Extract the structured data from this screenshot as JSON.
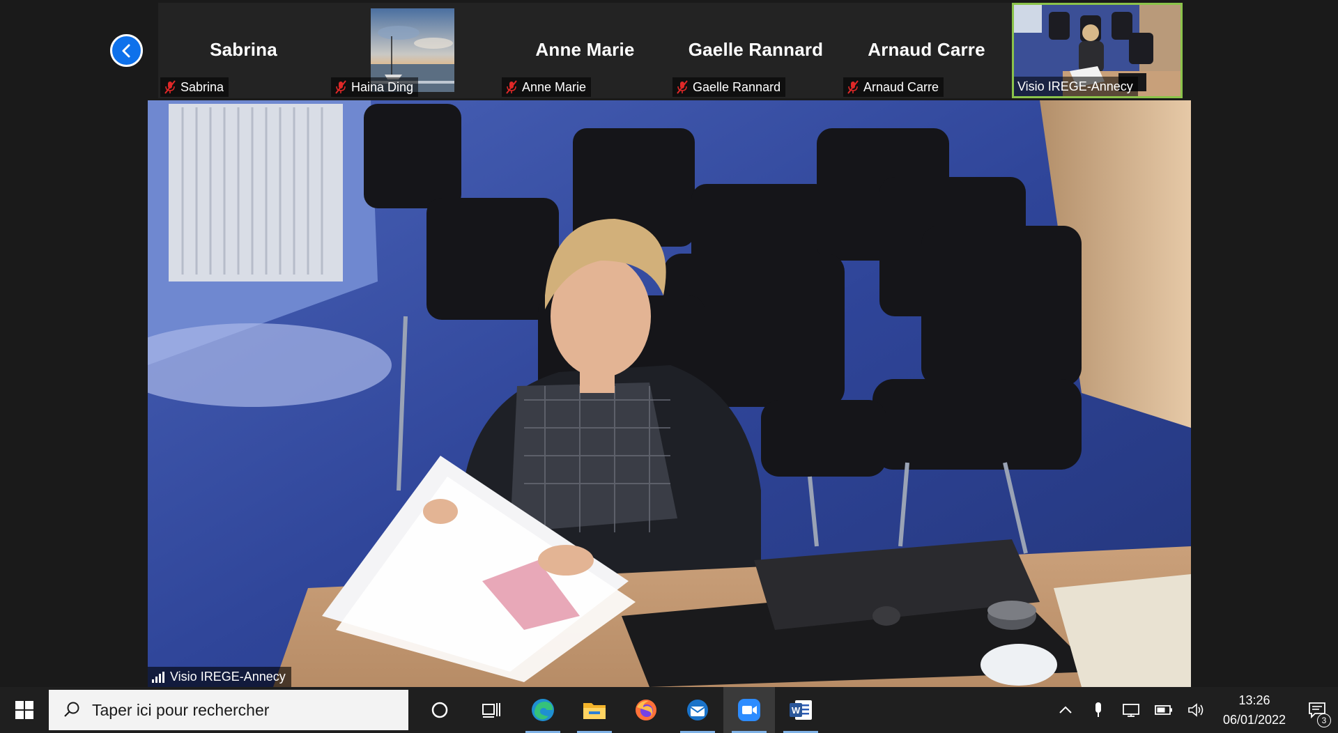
{
  "meeting": {
    "participants": [
      {
        "display_name": "Sabrina",
        "label": "Sabrina",
        "muted": true,
        "video": false
      },
      {
        "display_name": "",
        "label": "Haina Ding",
        "muted": true,
        "video": true
      },
      {
        "display_name": "Anne Marie",
        "label": "Anne Marie",
        "muted": true,
        "video": false
      },
      {
        "display_name": "Gaelle Rannard",
        "label": "Gaelle Rannard",
        "muted": true,
        "video": false
      },
      {
        "display_name": "Arnaud Carre",
        "label": "Arnaud Carre",
        "muted": true,
        "video": false
      },
      {
        "display_name": "",
        "label": "Visio IREGE-Annecy",
        "muted": false,
        "video": true,
        "active": true
      }
    ],
    "main_speaker_label": "Visio IREGE-Annecy",
    "active_border_color": "#8bc34a",
    "back_button_color": "#0e71eb"
  },
  "taskbar": {
    "search_placeholder": "Taper ici pour rechercher",
    "apps": [
      "cortana-icon",
      "task-view-icon",
      "edge-icon",
      "file-explorer-icon",
      "firefox-icon",
      "thunderbird-icon",
      "zoom-icon",
      "word-icon"
    ],
    "clock": {
      "time": "13:26",
      "date": "06/01/2022"
    },
    "notification_count": "3"
  }
}
